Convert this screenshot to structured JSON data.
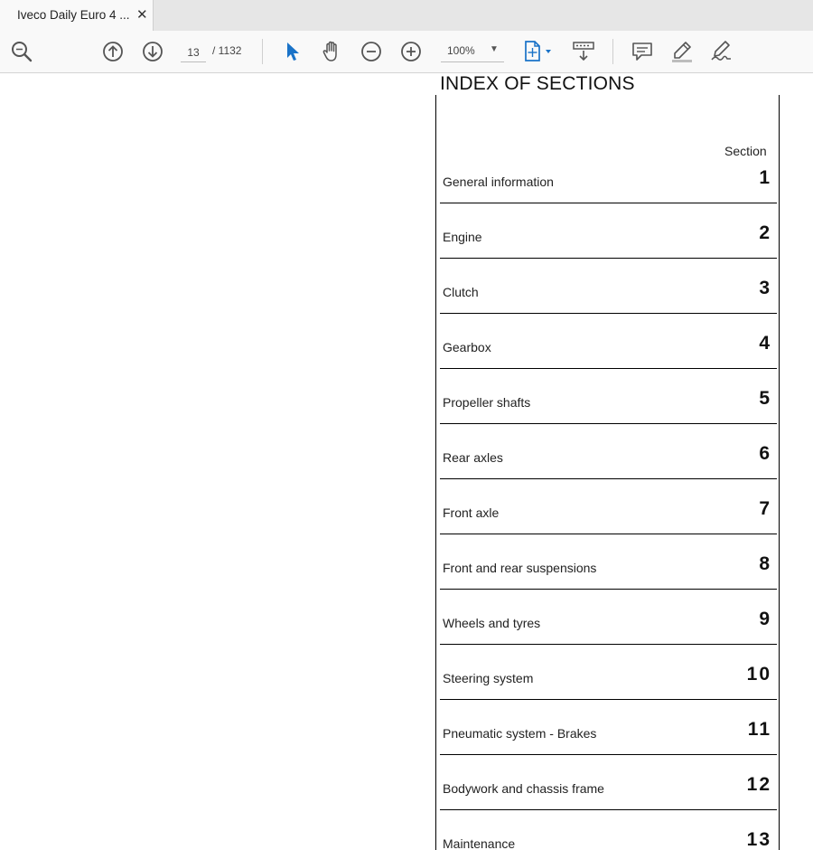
{
  "tab": {
    "title": "Iveco Daily Euro 4 ...",
    "close": "✕"
  },
  "toolbar": {
    "page_current": "13",
    "page_total": "/  1132",
    "zoom": "100%",
    "zoom_caret": "▼",
    "icons": [
      "search-icon",
      "previous-page-icon",
      "next-page-icon",
      "select-cursor-icon",
      "hand-tool-icon",
      "zoom-out-icon",
      "zoom-in-icon",
      "fit-page-icon",
      "scroll-mode-icon",
      "comment-icon",
      "highlight-icon",
      "sign-icon"
    ],
    "accent_color": "#1a73c8"
  },
  "document": {
    "title": "INDEX OF SECTIONS",
    "section_header": "Section",
    "rows": [
      {
        "label": "General information",
        "num": "1"
      },
      {
        "label": "Engine",
        "num": "2"
      },
      {
        "label": "Clutch",
        "num": "3"
      },
      {
        "label": "Gearbox",
        "num": "4"
      },
      {
        "label": "Propeller shafts",
        "num": "5"
      },
      {
        "label": "Rear axles",
        "num": "6"
      },
      {
        "label": "Front axle",
        "num": "7"
      },
      {
        "label": "Front and rear suspensions",
        "num": "8"
      },
      {
        "label": "Wheels and tyres",
        "num": "9"
      },
      {
        "label": "Steering system",
        "num": "10"
      },
      {
        "label": "Pneumatic system - Brakes",
        "num": "11"
      },
      {
        "label": "Bodywork and chassis frame",
        "num": "12"
      },
      {
        "label": "Maintenance",
        "num": "13"
      }
    ]
  }
}
